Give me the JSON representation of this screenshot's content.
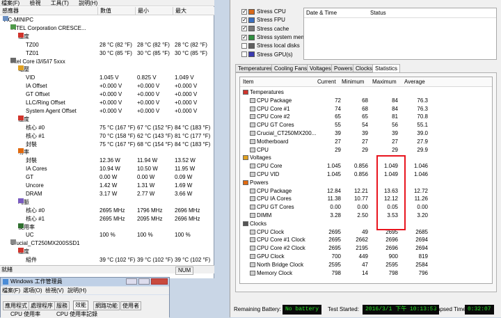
{
  "hwmonitor": {
    "menu": [
      "檔案(F)",
      "檢視",
      "工具(T)",
      "說明(H)"
    ],
    "columns": [
      "感應器",
      "數值",
      "最小",
      "最大"
    ],
    "rows": [
      {
        "indent": 0,
        "icon": "computer-icon",
        "name": "VIC-MINIPC",
        "val": "",
        "min": "",
        "max": ""
      },
      {
        "indent": 1,
        "icon": "board-icon",
        "name": "INTEL Corporation CRESCE...",
        "val": "",
        "min": "",
        "max": ""
      },
      {
        "indent": 2,
        "icon": "thermometer-icon",
        "name": "溫度",
        "val": "",
        "min": "",
        "max": ""
      },
      {
        "indent": 3,
        "icon": "",
        "name": "TZ00",
        "val": "28 °C (82 °F)",
        "min": "28 °C (82 °F)",
        "max": "28 °C (82 °F)"
      },
      {
        "indent": 3,
        "icon": "",
        "name": "TZ01",
        "val": "30 °C (85 °F)",
        "min": "30 °C (85 °F)",
        "max": "30 °C (85 °F)"
      },
      {
        "indent": 1,
        "icon": "cpu-icon",
        "name": "Intel Core i3/i5/i7 5xxx",
        "val": "",
        "min": "",
        "max": ""
      },
      {
        "indent": 2,
        "icon": "voltage-icon",
        "name": "電壓",
        "val": "",
        "min": "",
        "max": ""
      },
      {
        "indent": 3,
        "icon": "",
        "name": "VID",
        "val": "1.045 V",
        "min": "0.825 V",
        "max": "1.049 V"
      },
      {
        "indent": 3,
        "icon": "",
        "name": "IA Offset",
        "val": "+0.000 V",
        "min": "+0.000 V",
        "max": "+0.000 V"
      },
      {
        "indent": 3,
        "icon": "",
        "name": "GT Offset",
        "val": "+0.000 V",
        "min": "+0.000 V",
        "max": "+0.000 V"
      },
      {
        "indent": 3,
        "icon": "",
        "name": "LLC/Ring Offset",
        "val": "+0.000 V",
        "min": "+0.000 V",
        "max": "+0.000 V"
      },
      {
        "indent": 3,
        "icon": "",
        "name": "System Agent Offset",
        "val": "+0.000 V",
        "min": "+0.000 V",
        "max": "+0.000 V"
      },
      {
        "indent": 2,
        "icon": "thermometer-icon",
        "name": "溫度",
        "val": "",
        "min": "",
        "max": ""
      },
      {
        "indent": 3,
        "icon": "",
        "name": "核心 #0",
        "val": "75 °C (167 °F)",
        "min": "67 °C (152 °F)",
        "max": "84 °C (183 °F)"
      },
      {
        "indent": 3,
        "icon": "",
        "name": "核心 #1",
        "val": "70 °C (158 °F)",
        "min": "62 °C (143 °F)",
        "max": "81 °C (177 °F)"
      },
      {
        "indent": 3,
        "icon": "",
        "name": "封裝",
        "val": "75 °C (167 °F)",
        "min": "68 °C (154 °F)",
        "max": "84 °C (183 °F)"
      },
      {
        "indent": 2,
        "icon": "power-icon",
        "name": "功率",
        "val": "",
        "min": "",
        "max": ""
      },
      {
        "indent": 3,
        "icon": "",
        "name": "封裝",
        "val": "12.36 W",
        "min": "11.94 W",
        "max": "13.52 W"
      },
      {
        "indent": 3,
        "icon": "",
        "name": "IA Cores",
        "val": "10.94 W",
        "min": "10.50 W",
        "max": "11.95 W"
      },
      {
        "indent": 3,
        "icon": "",
        "name": "GT",
        "val": "0.00 W",
        "min": "0.00 W",
        "max": "0.09 W"
      },
      {
        "indent": 3,
        "icon": "",
        "name": "Uncore",
        "val": "1.42 W",
        "min": "1.31 W",
        "max": "1.69 W"
      },
      {
        "indent": 3,
        "icon": "",
        "name": "DRAM",
        "val": "3.17 W",
        "min": "2.77 W",
        "max": "3.66 W"
      },
      {
        "indent": 2,
        "icon": "clock-icon",
        "name": "時脈",
        "val": "",
        "min": "",
        "max": ""
      },
      {
        "indent": 3,
        "icon": "",
        "name": "核心 #0",
        "val": "2695 MHz",
        "min": "1796 MHz",
        "max": "2696 MHz"
      },
      {
        "indent": 3,
        "icon": "",
        "name": "核心 #1",
        "val": "2695 MHz",
        "min": "2095 MHz",
        "max": "2696 MHz"
      },
      {
        "indent": 2,
        "icon": "usage-icon",
        "name": "使用率",
        "val": "",
        "min": "",
        "max": ""
      },
      {
        "indent": 3,
        "icon": "",
        "name": "UC",
        "val": "100 %",
        "min": "100 %",
        "max": "100 %"
      },
      {
        "indent": 1,
        "icon": "drive-icon",
        "name": "Crucial_CT250MX200SSD1",
        "val": "",
        "min": "",
        "max": ""
      },
      {
        "indent": 2,
        "icon": "thermometer-icon",
        "name": "溫度",
        "val": "",
        "min": "",
        "max": ""
      },
      {
        "indent": 3,
        "icon": "",
        "name": "組件",
        "val": "39 °C (102 °F)",
        "min": "39 °C (102 °F)",
        "max": "39 °C (102 °F)"
      }
    ],
    "status_left": "就緒",
    "status_right": "NUM"
  },
  "taskmgr": {
    "title": "Windows 工作管理員",
    "menu": [
      "檔案(F)",
      "選項(O)",
      "檢視(V)",
      "說明(H)"
    ],
    "tabs": [
      "應用程式",
      "處理程序",
      "服務",
      "效能",
      "網路功能",
      "使用者"
    ],
    "cpu_label_1": "CPU 使用率",
    "cpu_label_2": "CPU 使用率記錄"
  },
  "stress": {
    "checks": [
      {
        "label": "Stress CPU",
        "checked": true,
        "icon": "cpu-icon"
      },
      {
        "label": "Stress FPU",
        "checked": true,
        "icon": "fpu-icon"
      },
      {
        "label": "Stress cache",
        "checked": true,
        "icon": "cache-icon"
      },
      {
        "label": "Stress system memory",
        "checked": true,
        "icon": "memory-icon"
      },
      {
        "label": "Stress local disks",
        "checked": false,
        "icon": "disk-icon"
      },
      {
        "label": "Stress GPU(s)",
        "checked": false,
        "icon": "gpu-icon"
      }
    ],
    "log_columns": [
      "Date & Time",
      "Status"
    ],
    "tabs": [
      "Temperatures",
      "Cooling Fans",
      "Voltages",
      "Powers",
      "Clocks",
      "Statistics"
    ],
    "active_tab": "Statistics",
    "stat_columns": [
      "Item",
      "Current",
      "Minimum",
      "Maximum",
      "Average"
    ],
    "rows": [
      {
        "group": true,
        "name": "Temperatures",
        "icon": "thermometer-icon"
      },
      {
        "name": "CPU Package",
        "cur": "72",
        "min": "68",
        "max": "84",
        "avg": "76.3"
      },
      {
        "name": "CPU Core #1",
        "cur": "74",
        "min": "68",
        "max": "84",
        "avg": "76.3"
      },
      {
        "name": "CPU Core #2",
        "cur": "65",
        "min": "65",
        "max": "81",
        "avg": "70.8"
      },
      {
        "name": "CPU GT Cores",
        "cur": "55",
        "min": "54",
        "max": "56",
        "avg": "55.1"
      },
      {
        "name": "Crucial_CT250MX200...",
        "cur": "39",
        "min": "39",
        "max": "39",
        "avg": "39.0"
      },
      {
        "name": "Motherboard",
        "cur": "27",
        "min": "27",
        "max": "27",
        "avg": "27.9"
      },
      {
        "name": "CPU",
        "cur": "29",
        "min": "29",
        "max": "29",
        "avg": "29.9"
      },
      {
        "group": true,
        "name": "Voltages",
        "icon": "voltage-icon"
      },
      {
        "name": "CPU Core",
        "cur": "1.045",
        "min": "0.856",
        "max": "1.049",
        "avg": "1.046"
      },
      {
        "name": "CPU VID",
        "cur": "1.045",
        "min": "0.856",
        "max": "1.049",
        "avg": "1.046"
      },
      {
        "group": true,
        "name": "Powers",
        "icon": "power-icon"
      },
      {
        "name": "CPU Package",
        "cur": "12.84",
        "min": "12.21",
        "max": "13.63",
        "avg": "12.72"
      },
      {
        "name": "CPU IA Cores",
        "cur": "11.38",
        "min": "10.77",
        "max": "12.12",
        "avg": "11.26"
      },
      {
        "name": "CPU GT Cores",
        "cur": "0.00",
        "min": "0.00",
        "max": "0.05",
        "avg": "0.00"
      },
      {
        "name": "DIMM",
        "cur": "3.28",
        "min": "2.50",
        "max": "3.53",
        "avg": "3.20"
      },
      {
        "group": true,
        "name": "Clocks",
        "icon": "clock-icon"
      },
      {
        "name": "CPU Clock",
        "cur": "2695",
        "min": "49",
        "max": "2695",
        "avg": "2685"
      },
      {
        "name": "CPU Core #1 Clock",
        "cur": "2695",
        "min": "2662",
        "max": "2696",
        "avg": "2694"
      },
      {
        "name": "CPU Core #2 Clock",
        "cur": "2695",
        "min": "2195",
        "max": "2696",
        "avg": "2694"
      },
      {
        "name": "GPU Clock",
        "cur": "700",
        "min": "449",
        "max": "900",
        "avg": "819"
      },
      {
        "name": "North Bridge Clock",
        "cur": "2595",
        "min": "47",
        "max": "2595",
        "avg": "2584"
      },
      {
        "name": "Memory Clock",
        "cur": "798",
        "min": "14",
        "max": "798",
        "avg": "796"
      }
    ],
    "battery_label": "Remaining Battery:",
    "battery_value": "No battery",
    "started_label": "Test Started:",
    "started_value": "2016/3/1 下午 10:13:53",
    "elapsed_label": "Elapsed Time:",
    "elapsed_value": "0:32:07",
    "highlight_color": "#e8141e",
    "readout_color": "#26e626"
  }
}
